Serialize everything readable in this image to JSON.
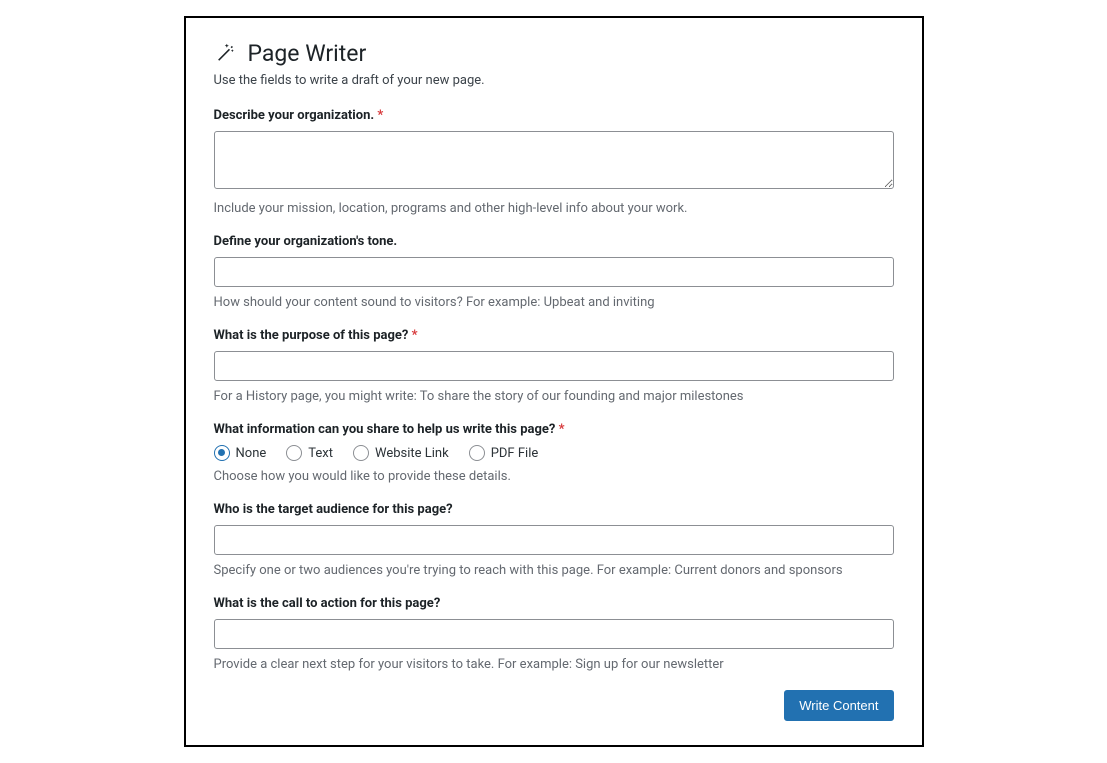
{
  "header": {
    "title": "Page Writer",
    "subtitle": "Use the fields to write a draft of your new page."
  },
  "fields": {
    "describe": {
      "label": "Describe your organization.",
      "required": true,
      "value": "",
      "help": "Include your mission, location, programs and other high-level info about your work."
    },
    "tone": {
      "label": "Define your organization's tone.",
      "required": false,
      "value": "",
      "help": "How should your content sound to visitors? For example: Upbeat and inviting"
    },
    "purpose": {
      "label": "What is the purpose of this page?",
      "required": true,
      "value": "",
      "help": "For a History page, you might write: To share the story of our founding and major milestones"
    },
    "info": {
      "label": "What information can you share to help us write this page?",
      "required": true,
      "options": {
        "none": "None",
        "text": "Text",
        "link": "Website Link",
        "pdf": "PDF File"
      },
      "selected": "none",
      "help": "Choose how you would like to provide these details."
    },
    "audience": {
      "label": "Who is the target audience for this page?",
      "required": false,
      "value": "",
      "help": "Specify one or two audiences you're trying to reach with this page. For example: Current donors and sponsors"
    },
    "cta": {
      "label": "What is the call to action for this page?",
      "required": false,
      "value": "",
      "help": "Provide a clear next step for your visitors to take. For example: Sign up for our newsletter"
    }
  },
  "actions": {
    "submit": "Write Content"
  }
}
